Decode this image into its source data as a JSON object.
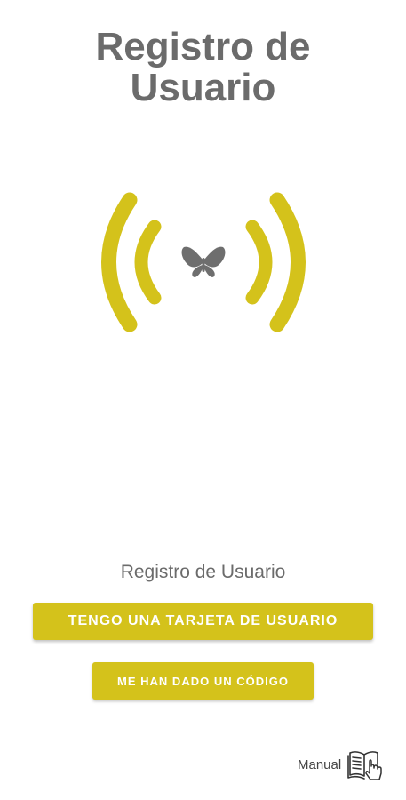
{
  "header": {
    "title_line1": "Registro de",
    "title_line2": "Usuario"
  },
  "hero": {
    "icon": "butterfly-icon",
    "graphic": "signal-waves"
  },
  "main": {
    "subtitle": "Registro de Usuario",
    "primary_button": "TENGO UNA TARJETA DE USUARIO",
    "secondary_button": "ME HAN DADO UN CÓDIGO"
  },
  "footer": {
    "manual_label": "Manual",
    "manual_icon": "book-pointer-icon"
  },
  "colors": {
    "accent": "#d4c21b",
    "title_text": "#6b6b6b",
    "butterfly": "#6e6e6e",
    "background": "#ffffff"
  }
}
